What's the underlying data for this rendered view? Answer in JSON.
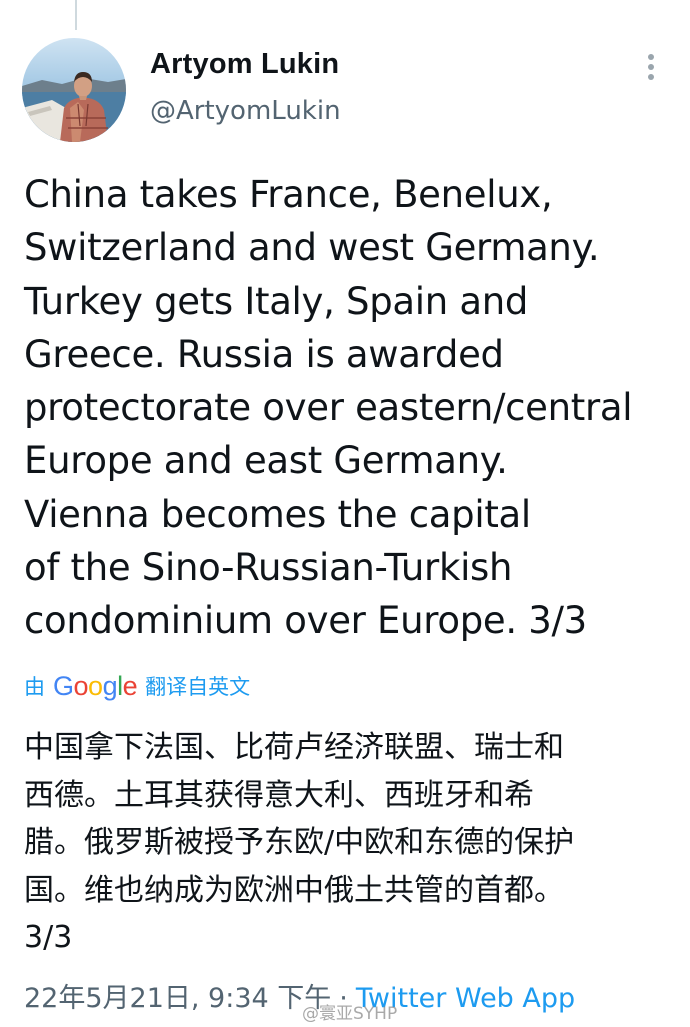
{
  "tweet": {
    "author": {
      "display_name": "Artyom Lukin",
      "handle": "@ArtyomLukin",
      "avatar_icon": "profile-photo"
    },
    "more_icon": "more-vertical-icon",
    "text": "China takes France, Benelux,\nSwitzerland and west Germany.\nTurkey gets Italy, Spain and\nGreece. Russia is awarded\nprotectorate over eastern/central\nEurope and east Germany.\nVienna becomes the capital\nof the Sino-Russian-Turkish\ncondominium over Europe. 3/3",
    "translation": {
      "prefix": "由",
      "provider": "Google",
      "suffix": "翻译自英文",
      "text": "中国拿下法国、比荷卢经济联盟、瑞士和\n西德。土耳其获得意大利、西班牙和希\n腊。俄罗斯被授予东欧/中欧和东德的保护\n国。维也纳成为欧洲中俄土共管的首都。\n3/3"
    },
    "meta": {
      "timestamp": "22年5月21日, 9:34 下午",
      "separator": "·",
      "source": "Twitter Web App"
    }
  },
  "watermark": "@寰亚SYHP",
  "colors": {
    "link": "#1d9bf0",
    "secondary": "#536471",
    "google_blue": "#4285F4",
    "google_red": "#EA4335",
    "google_yellow": "#FBBC05",
    "google_green": "#34A853"
  }
}
